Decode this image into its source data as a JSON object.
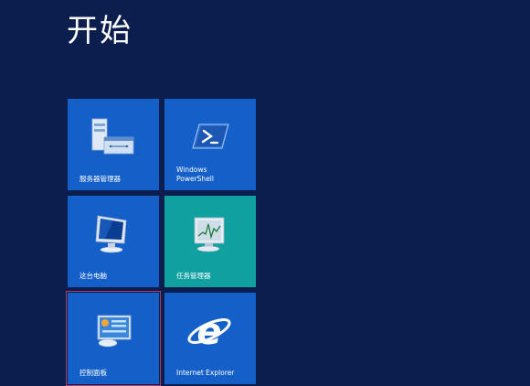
{
  "start": {
    "title": "开始"
  },
  "tiles": [
    {
      "label": "服务器管理器",
      "icon": "server-manager-icon",
      "color": "#1560c8"
    },
    {
      "label": "Windows\nPowerShell",
      "icon": "powershell-icon",
      "color": "#1560c8"
    },
    {
      "label": "这台电脑",
      "icon": "computer-icon",
      "color": "#1560c8"
    },
    {
      "label": "任务管理器",
      "icon": "task-manager-icon",
      "color": "#11a0a0"
    },
    {
      "label": "控制面板",
      "icon": "control-panel-icon",
      "color": "#1560c8"
    },
    {
      "label": "Internet Explorer",
      "icon": "internet-explorer-icon",
      "color": "#1560c8"
    }
  ],
  "colors": {
    "background": "#0c1e4e",
    "tile_blue": "#1560c8",
    "tile_teal": "#11a0a0",
    "selection_outline": "#b63a64"
  }
}
